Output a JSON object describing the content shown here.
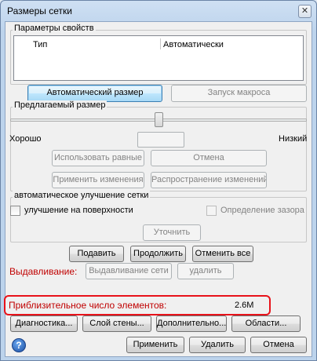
{
  "window": {
    "title": "Размеры сетки",
    "close_glyph": "✕"
  },
  "properties": {
    "group_label": "Параметры свойств",
    "rows": [
      {
        "name": "Тип",
        "value": "Автоматически"
      }
    ]
  },
  "buttons": {
    "auto_size": "Автоматический размер",
    "run_macro": "Запуск макроса"
  },
  "suggested_size": {
    "group_label": "Предлагаемый размер",
    "slider_left_label": "Хорошо",
    "slider_right_label": "Низкий",
    "slider_position_percent": 50,
    "value_box": "",
    "use_equal": "Использовать равные",
    "cancel": "Отмена",
    "apply_changes": "Применить изменения",
    "propagate_changes": "Распространение изменений"
  },
  "auto_improve": {
    "group_label": "автоматическое улучшение сетки",
    "surface_improvement_label": "улучшение на поверхности",
    "surface_improvement_checked": false,
    "gap_detection_label": "Определение зазора",
    "gap_detection_checked": false,
    "refine_button": "Уточнить"
  },
  "action_buttons": {
    "suppress": "Подавить",
    "resume": "Продолжить",
    "undo_all": "Отменить все"
  },
  "extrusion": {
    "label": "Выдавливание:",
    "extrude_mesh_button": "Выдавливание сети",
    "delete_button": "удалить"
  },
  "element_count": {
    "label": "Приблизительное число элементов:",
    "value": "2.6M",
    "highlight_color": "#e8121a"
  },
  "bottom_row": {
    "diagnostics": "Диагностика...",
    "wall_layer": "Слой стены...",
    "advanced": "Дополнительно...",
    "regions": "Области..."
  },
  "footer": {
    "help_icon": "?",
    "apply": "Применить",
    "delete": "Удалить",
    "cancel": "Отмена"
  },
  "colors": {
    "accent_red": "#c00000",
    "window_frame": "#bcd3ec",
    "dialog_bg": "#f0f0f0"
  }
}
